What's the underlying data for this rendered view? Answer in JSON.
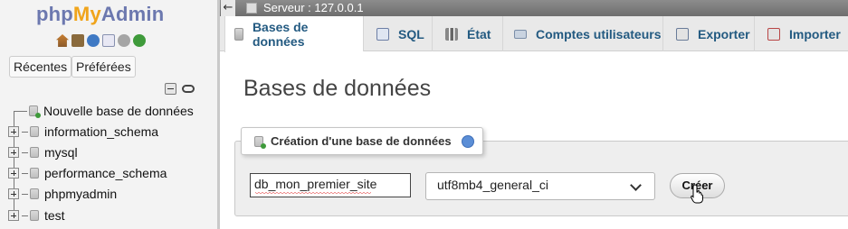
{
  "nav": {
    "logo": {
      "php": "php",
      "my": "My",
      "admin": "Admin"
    },
    "icons": [
      "home-icon",
      "exit-icon",
      "help-icon",
      "docs-icon",
      "settings-icon",
      "reload-icon"
    ],
    "buttons": {
      "recent": "Récentes",
      "favorites": "Préférées"
    },
    "tree": [
      {
        "label": "Nouvelle base de données",
        "type": "new"
      },
      {
        "label": "information_schema",
        "type": "db"
      },
      {
        "label": "mysql",
        "type": "db"
      },
      {
        "label": "performance_schema",
        "type": "db"
      },
      {
        "label": "phpmyadmin",
        "type": "db"
      },
      {
        "label": "test",
        "type": "db"
      }
    ]
  },
  "topbar": {
    "back": "←",
    "server": "Serveur : 127.0.0.1"
  },
  "tabs": [
    {
      "label": "Bases de données",
      "active": true
    },
    {
      "label": "SQL",
      "active": false
    },
    {
      "label": "État",
      "active": false
    },
    {
      "label": "Comptes utilisateurs",
      "active": false
    },
    {
      "label": "Exporter",
      "active": false
    },
    {
      "label": "Importer",
      "active": false
    }
  ],
  "main": {
    "title": "Bases de données",
    "create": {
      "legend": "Création d'une base de données",
      "db_name_value": "db_mon_premier_site",
      "collation": "utf8mb4_general_ci",
      "button": "Créer"
    }
  },
  "colors": {
    "link": "#235a81",
    "logo_blue": "#6c78af",
    "logo_orange": "#f0a41b"
  }
}
